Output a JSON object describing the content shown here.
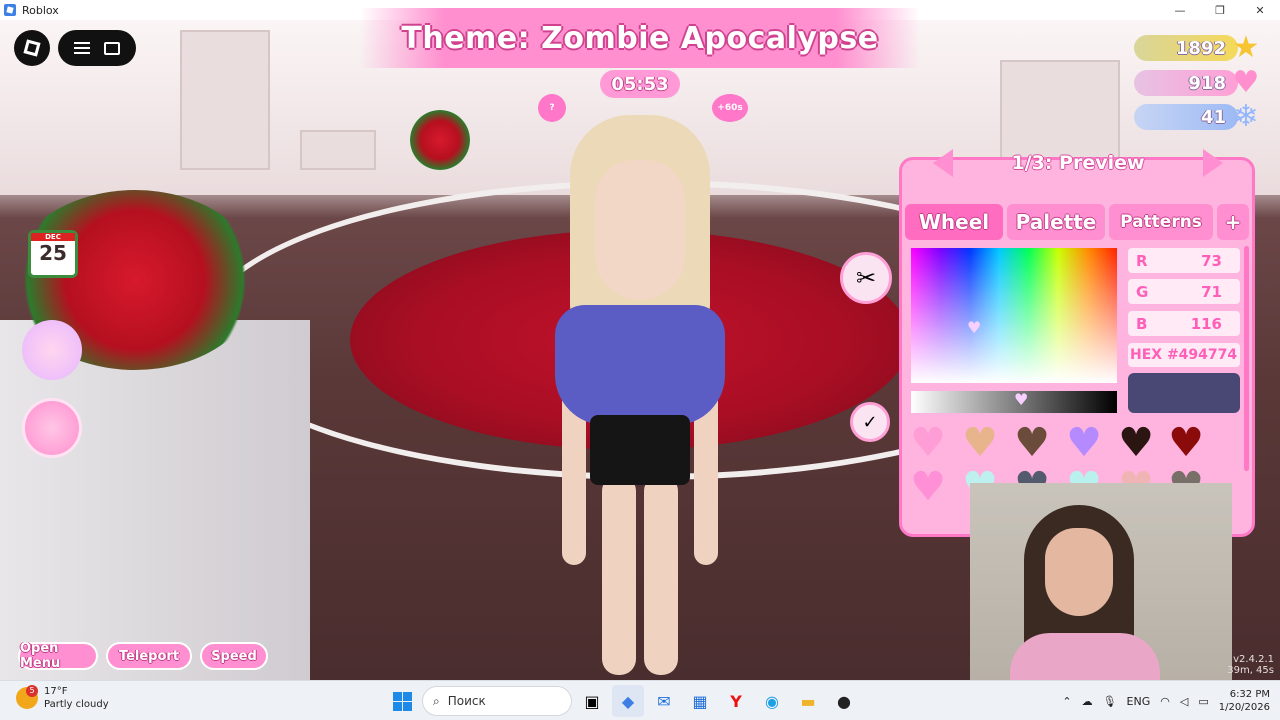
{
  "window": {
    "title": "Roblox",
    "minimize_icon": "—",
    "restore_icon": "❐",
    "close_icon": "✕"
  },
  "hud": {
    "theme_text": "Theme: Zombie Apocalypse",
    "timer": "05:53",
    "bonus_label": "+60s",
    "calendar_month": "DEC",
    "calendar_day": "25"
  },
  "currencies": [
    {
      "value": "1892",
      "icon": "★",
      "color": "#f6c531"
    },
    {
      "value": "918",
      "icon": "♥",
      "color": "#ff8fcf"
    },
    {
      "value": "41",
      "icon": "❄",
      "color": "#8fb6ff"
    }
  ],
  "panel": {
    "nav_label": "1/3: Preview",
    "tabs": [
      "Wheel",
      "Palette",
      "Patterns",
      "+"
    ],
    "r_label": "R",
    "r_value": "73",
    "g_label": "G",
    "g_value": "71",
    "b_label": "B",
    "b_value": "116",
    "hex_label": "HEX #494774",
    "preview_color": "#494774",
    "swatches": [
      "#ff9ed6",
      "#e8b48c",
      "#6b4c3a",
      "#b68aff",
      "#2b1511",
      "#8b0b0b",
      "#ff8fd6",
      "#bdf0ee",
      "#555b6e",
      "#b8f1ee",
      "#f0b4b4",
      "#787068"
    ]
  },
  "bottom_buttons": {
    "open_menu": "Open Menu",
    "teleport": "Teleport",
    "speed": "Speed"
  },
  "version": {
    "line1": "v2.4.2.1",
    "line2": "39m, 45s"
  },
  "taskbar": {
    "weather_temp": "17°F",
    "weather_desc": "Partly cloudy",
    "weather_badge": "5",
    "search_placeholder": "Поиск",
    "language": "ENG",
    "time": "6:32 PM",
    "date": "1/20/2026"
  }
}
